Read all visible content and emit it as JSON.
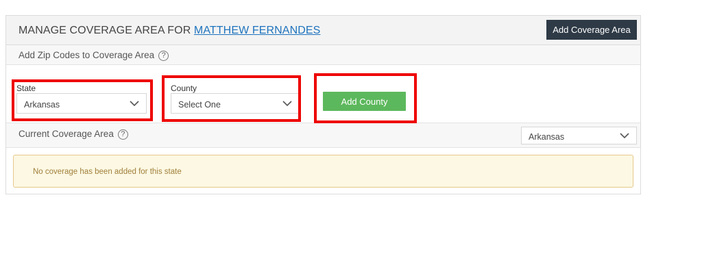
{
  "header": {
    "title_prefix": "MANAGE COVERAGE AREA FOR",
    "user_name": "MATTHEW FERNANDES",
    "add_coverage_label": "Add Coverage Area"
  },
  "zip_section": {
    "label": "Add Zip Codes to Coverage Area",
    "help_glyph": "?"
  },
  "form": {
    "state_label": "State",
    "state_value": "Arkansas",
    "county_label": "County",
    "county_value": "Select One",
    "add_county_label": "Add County"
  },
  "current_coverage": {
    "label": "Current Coverage Area",
    "help_glyph": "?",
    "state_filter_value": "Arkansas",
    "empty_message": "No coverage has been added for this state"
  },
  "colors": {
    "primary_button": "#2e3a46",
    "success_button": "#5cb85c",
    "highlight": "#ee0000",
    "link": "#1e73be"
  }
}
